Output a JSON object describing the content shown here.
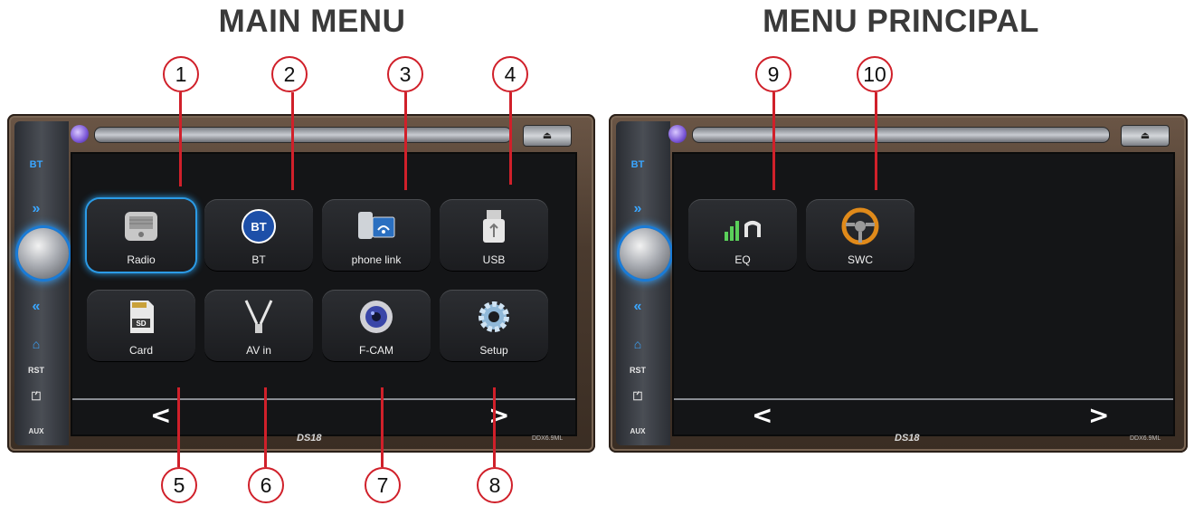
{
  "left_title": "MAIN MENU",
  "right_title": "MENU PRINCIPAL",
  "callouts": [
    "1",
    "2",
    "3",
    "4",
    "5",
    "6",
    "7",
    "8",
    "9",
    "10"
  ],
  "side_panel": {
    "bt": "BT",
    "next": "»",
    "prev": "«",
    "home": "⌂",
    "rst": "RST",
    "usb": "⏍",
    "aux": "AUX"
  },
  "eject_label": "⏏",
  "main_menu": {
    "tiles": [
      {
        "label": "Radio",
        "icon": "radio-icon",
        "selected": true
      },
      {
        "label": "BT",
        "icon": "bluetooth-icon"
      },
      {
        "label": "phone link",
        "icon": "phone-link-icon"
      },
      {
        "label": "USB",
        "icon": "usb-icon"
      },
      {
        "label": "Card",
        "icon": "sd-card-icon"
      },
      {
        "label": "AV in",
        "icon": "av-in-icon"
      },
      {
        "label": "F-CAM",
        "icon": "camera-icon"
      },
      {
        "label": "Setup",
        "icon": "gear-icon"
      }
    ],
    "prev": "<",
    "next": ">"
  },
  "principal_menu": {
    "tiles": [
      {
        "label": "EQ",
        "icon": "equalizer-icon"
      },
      {
        "label": "SWC",
        "icon": "steering-wheel-icon"
      }
    ],
    "prev": "<",
    "next": ">"
  },
  "brand": "DS18",
  "model": "DDX6.9ML",
  "colors": {
    "callout": "#d0202a",
    "accent": "#2b9be6",
    "screen": "#141517"
  }
}
